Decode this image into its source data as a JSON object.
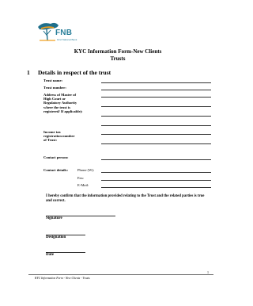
{
  "header": {
    "brand": "FNB",
    "tagline": "First National Bank",
    "title_line1": "KYC Information Form-New Clients",
    "title_line2": "Trusts"
  },
  "section": {
    "number": "1",
    "title": "Details in respect of the trust"
  },
  "fields": {
    "trust_name": "Trust name:",
    "trust_number": "Trust number:",
    "address_master": "Address of Master of High Court or Regulatory Authority where the trust is registered/ If applicable):",
    "income_tax": "Income tax registration number of Trust:",
    "contact_person": "Contact person:",
    "contact_details": "Contact details:",
    "phone": "Phone (W):",
    "fax": "Fax:",
    "email": "E-Mail:"
  },
  "confirmation": "I hereby confirm that the information provided relating to the Trust and the related parties is true and correct.",
  "signature_labels": {
    "signature": "Signature",
    "designation": "Designation",
    "date": "Date"
  },
  "footer": {
    "text": "KYC Information Form - New Clients - Trusts",
    "page_number": "1"
  },
  "colors": {
    "brand_blue": "#2a7f9a",
    "brand_orange": "#f0a020",
    "tree": "#1f6f8b"
  }
}
